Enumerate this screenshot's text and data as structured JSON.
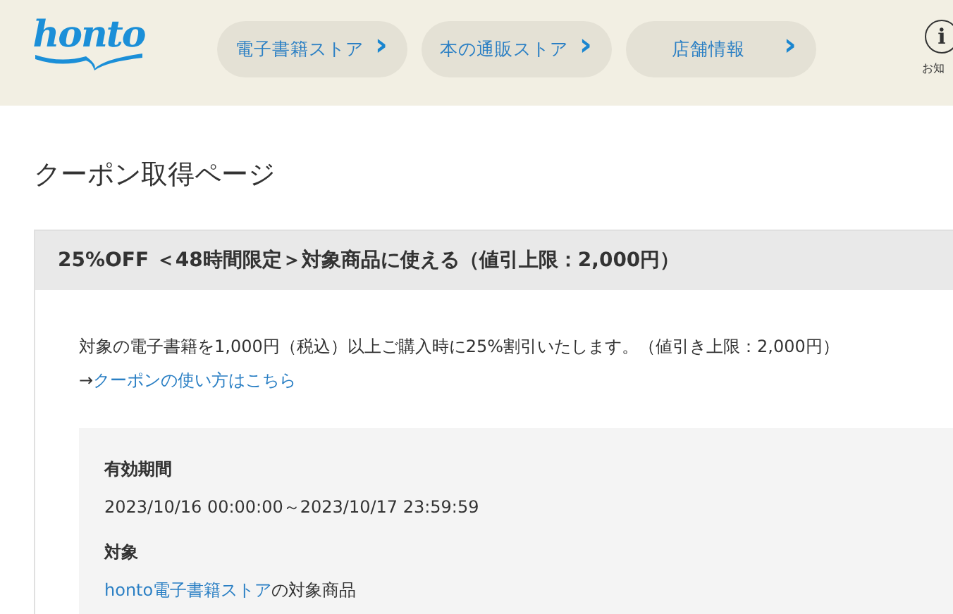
{
  "header": {
    "logo": "honto",
    "nav": [
      {
        "label": "電子書籍ストア",
        "chevron": "›"
      },
      {
        "label": "本の通販ストア",
        "chevron": "›"
      },
      {
        "label": "店舗情報",
        "chevron": "›"
      }
    ],
    "info": {
      "icon": "i",
      "label": "お知"
    }
  },
  "page_title": "クーポン取得ページ",
  "coupon": {
    "title": "25%OFF ＜48時間限定＞対象商品に使える（値引上限：2,000円）",
    "description": "対象の電子書籍を1,000円（税込）以上ご購入時に25%割引いたします。（値引き上限：2,000円）",
    "usage_arrow": "→",
    "usage_link": "クーポンの使い方はこちら",
    "details": [
      {
        "label": "有効期間",
        "value": "2023/10/16 00:00:00～2023/10/17 23:59:59"
      },
      {
        "label": "対象",
        "link": "honto電子書籍ストア",
        "value": "の対象商品"
      }
    ]
  }
}
